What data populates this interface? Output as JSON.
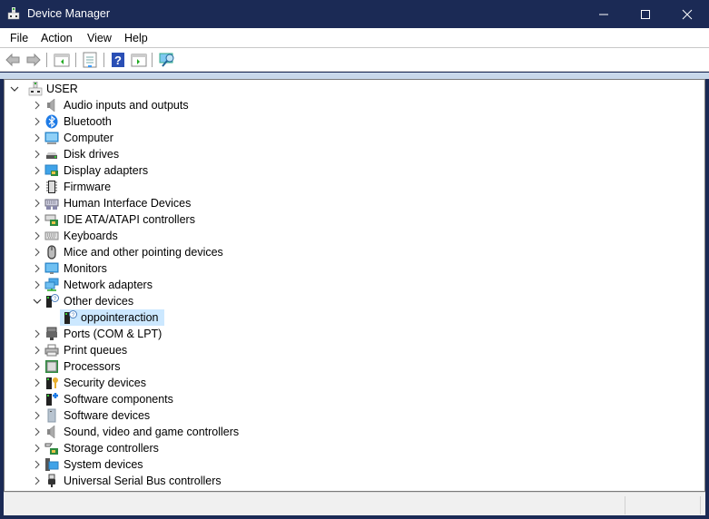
{
  "window": {
    "title": "Device Manager"
  },
  "menu": [
    "File",
    "Action",
    "View",
    "Help"
  ],
  "toolbar": [
    "back-icon",
    "forward-icon",
    "show-hide-console-tree-icon",
    "properties-icon",
    "help-icon",
    "show-action-pane-icon",
    "scan-hardware-icon"
  ],
  "tree": {
    "root": "USER",
    "categories": [
      {
        "label": "Audio inputs and outputs",
        "icon": "speaker-icon",
        "expanded": false
      },
      {
        "label": "Bluetooth",
        "icon": "bluetooth-icon",
        "expanded": false
      },
      {
        "label": "Computer",
        "icon": "computer-icon",
        "expanded": false
      },
      {
        "label": "Disk drives",
        "icon": "disk-drive-icon",
        "expanded": false
      },
      {
        "label": "Display adapters",
        "icon": "display-adapter-icon",
        "expanded": false
      },
      {
        "label": "Firmware",
        "icon": "firmware-chip-icon",
        "expanded": false
      },
      {
        "label": "Human Interface Devices",
        "icon": "hid-icon",
        "expanded": false
      },
      {
        "label": "IDE ATA/ATAPI controllers",
        "icon": "ide-controller-icon",
        "expanded": false
      },
      {
        "label": "Keyboards",
        "icon": "keyboard-icon",
        "expanded": false
      },
      {
        "label": "Mice and other pointing devices",
        "icon": "mouse-icon",
        "expanded": false
      },
      {
        "label": "Monitors",
        "icon": "monitor-icon",
        "expanded": false
      },
      {
        "label": "Network adapters",
        "icon": "network-adapter-icon",
        "expanded": false
      },
      {
        "label": "Other devices",
        "icon": "unknown-device-icon",
        "expanded": true,
        "children": [
          {
            "label": "oppointeraction",
            "icon": "unknown-device-icon",
            "selected": true
          }
        ]
      },
      {
        "label": "Ports (COM & LPT)",
        "icon": "port-icon",
        "expanded": false
      },
      {
        "label": "Print queues",
        "icon": "printer-icon",
        "expanded": false
      },
      {
        "label": "Processors",
        "icon": "processor-icon",
        "expanded": false
      },
      {
        "label": "Security devices",
        "icon": "security-device-icon",
        "expanded": false
      },
      {
        "label": "Software components",
        "icon": "software-component-icon",
        "expanded": false
      },
      {
        "label": "Software devices",
        "icon": "software-device-icon",
        "expanded": false
      },
      {
        "label": "Sound, video and game controllers",
        "icon": "speaker-icon",
        "expanded": false
      },
      {
        "label": "Storage controllers",
        "icon": "storage-controller-icon",
        "expanded": false
      },
      {
        "label": "System devices",
        "icon": "system-device-icon",
        "expanded": false
      },
      {
        "label": "Universal Serial Bus controllers",
        "icon": "usb-icon",
        "expanded": false
      }
    ]
  }
}
